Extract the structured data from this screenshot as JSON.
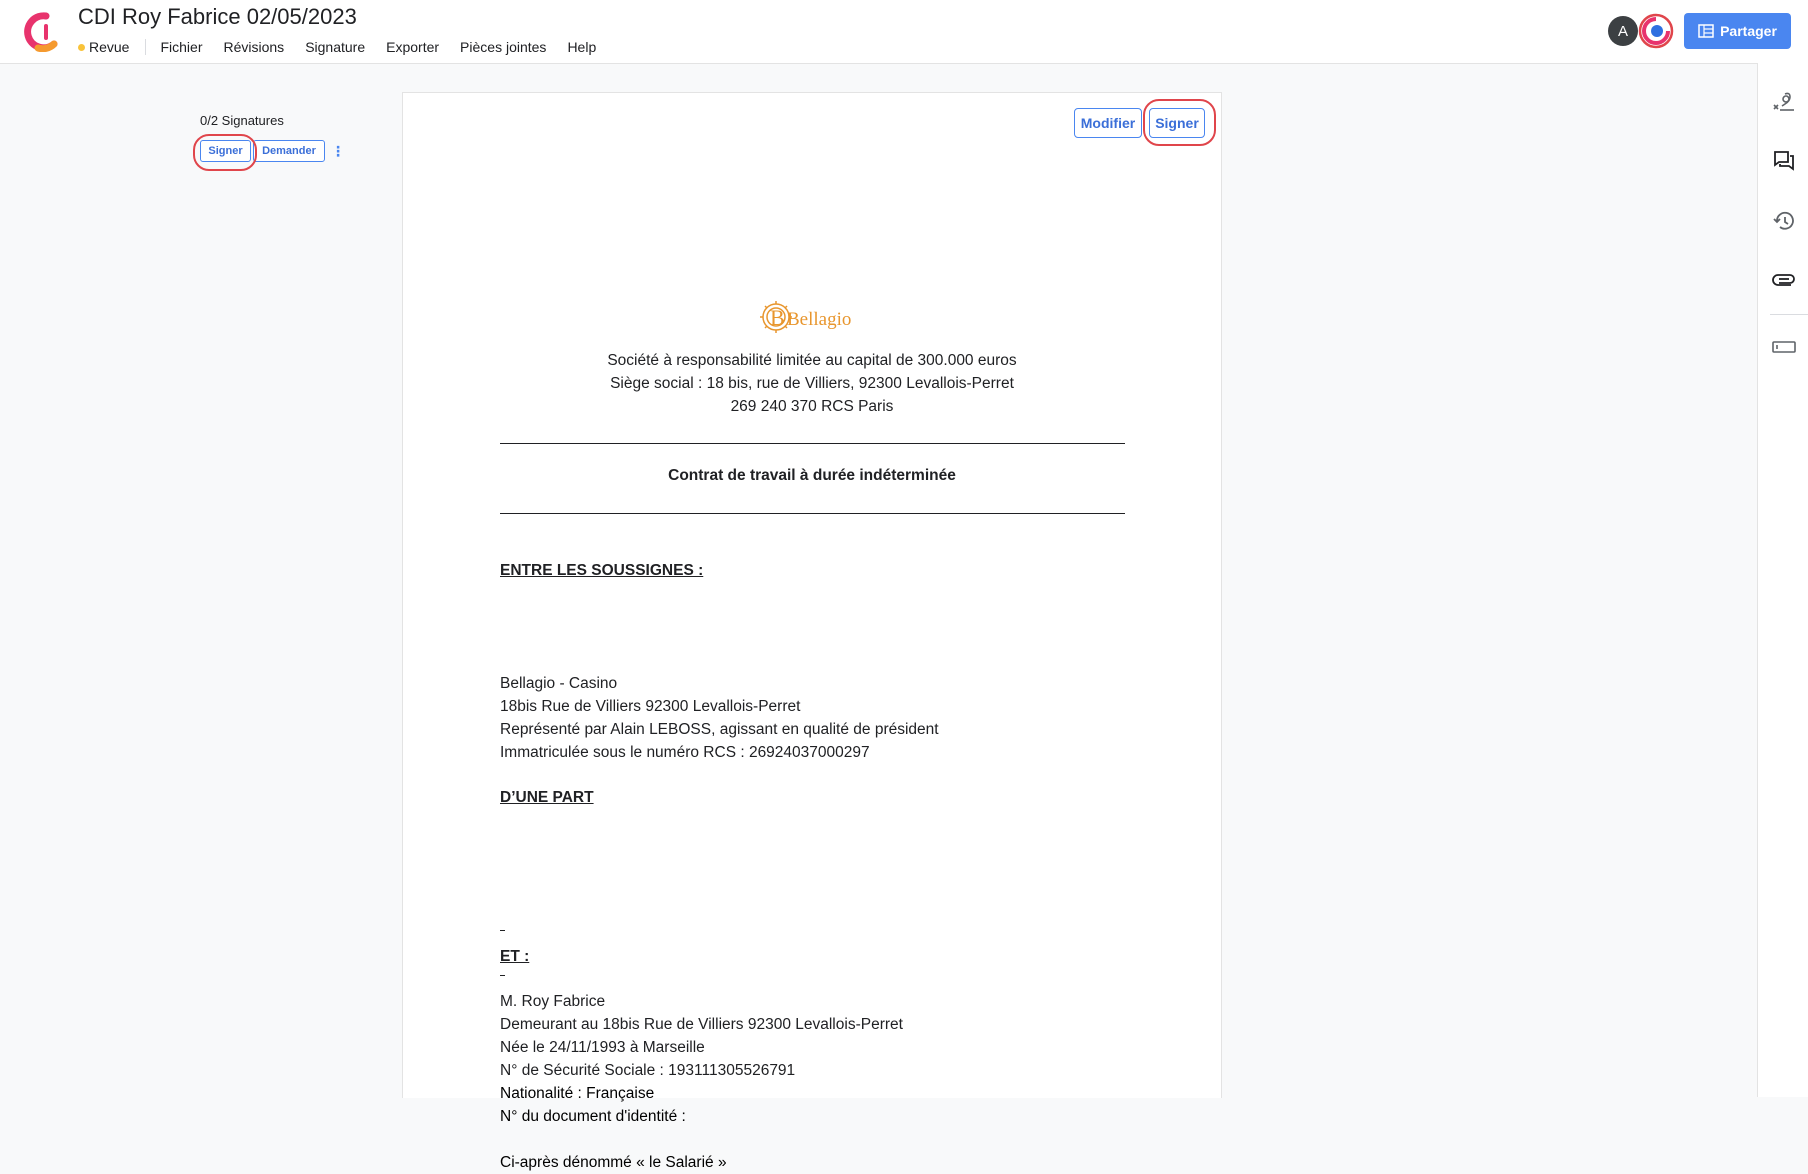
{
  "app": {
    "title": "CDI Roy Fabrice 02/05/2023",
    "status": "Revue",
    "status_color": "#f9c33a",
    "menu": [
      "Fichier",
      "Révisions",
      "Signature",
      "Exporter",
      "Pièces jointes",
      "Help"
    ],
    "avatar_initial": "A",
    "share_label": "Partager",
    "accent_color": "#4a86f0"
  },
  "signatures_panel": {
    "count_label": "0/2 Signatures",
    "sign_label": "Signer",
    "request_label": "Demander",
    "more_icon": "kebab-vertical-icon"
  },
  "document": {
    "modify_label": "Modifier",
    "sign_label": "Signer",
    "logo_text": "Bellagio",
    "company_lines": [
      "Société à responsabilité limitée au capital de 300.000 euros",
      "Siège social : 18 bis, rue de Villiers, 92300 Levallois-Perret",
      "269 240 370 RCS Paris"
    ],
    "contract_title": "Contrat de travail à durée indéterminée",
    "between_heading": "ENTRE LES SOUSSIGNES :",
    "employer_lines": [
      "Bellagio - Casino",
      "18bis Rue de Villiers 92300 Levallois-Perret",
      "Représenté par Alain LEBOSS, agissant en qualité de président",
      "Immatriculée sous le numéro RCS : 26924037000297"
    ],
    "party_one_heading": "D’UNE PART",
    "and_heading": "ET :",
    "employee_lines": [
      "M. Roy Fabrice",
      "Demeurant au 18bis Rue de Villiers 92300 Levallois-Perret",
      "Née le 24/11/1993 à Marseille",
      "N° de Sécurité Sociale : 193111305526791",
      "Nationalité : Française",
      "N° du document d'identité :"
    ],
    "employee_alias": "Ci-après dénommé « le Salarié »"
  },
  "right_toolbar": {
    "icons": [
      "signature-icon",
      "comments-icon",
      "history-icon",
      "attachment-icon",
      "fields-icon"
    ]
  }
}
